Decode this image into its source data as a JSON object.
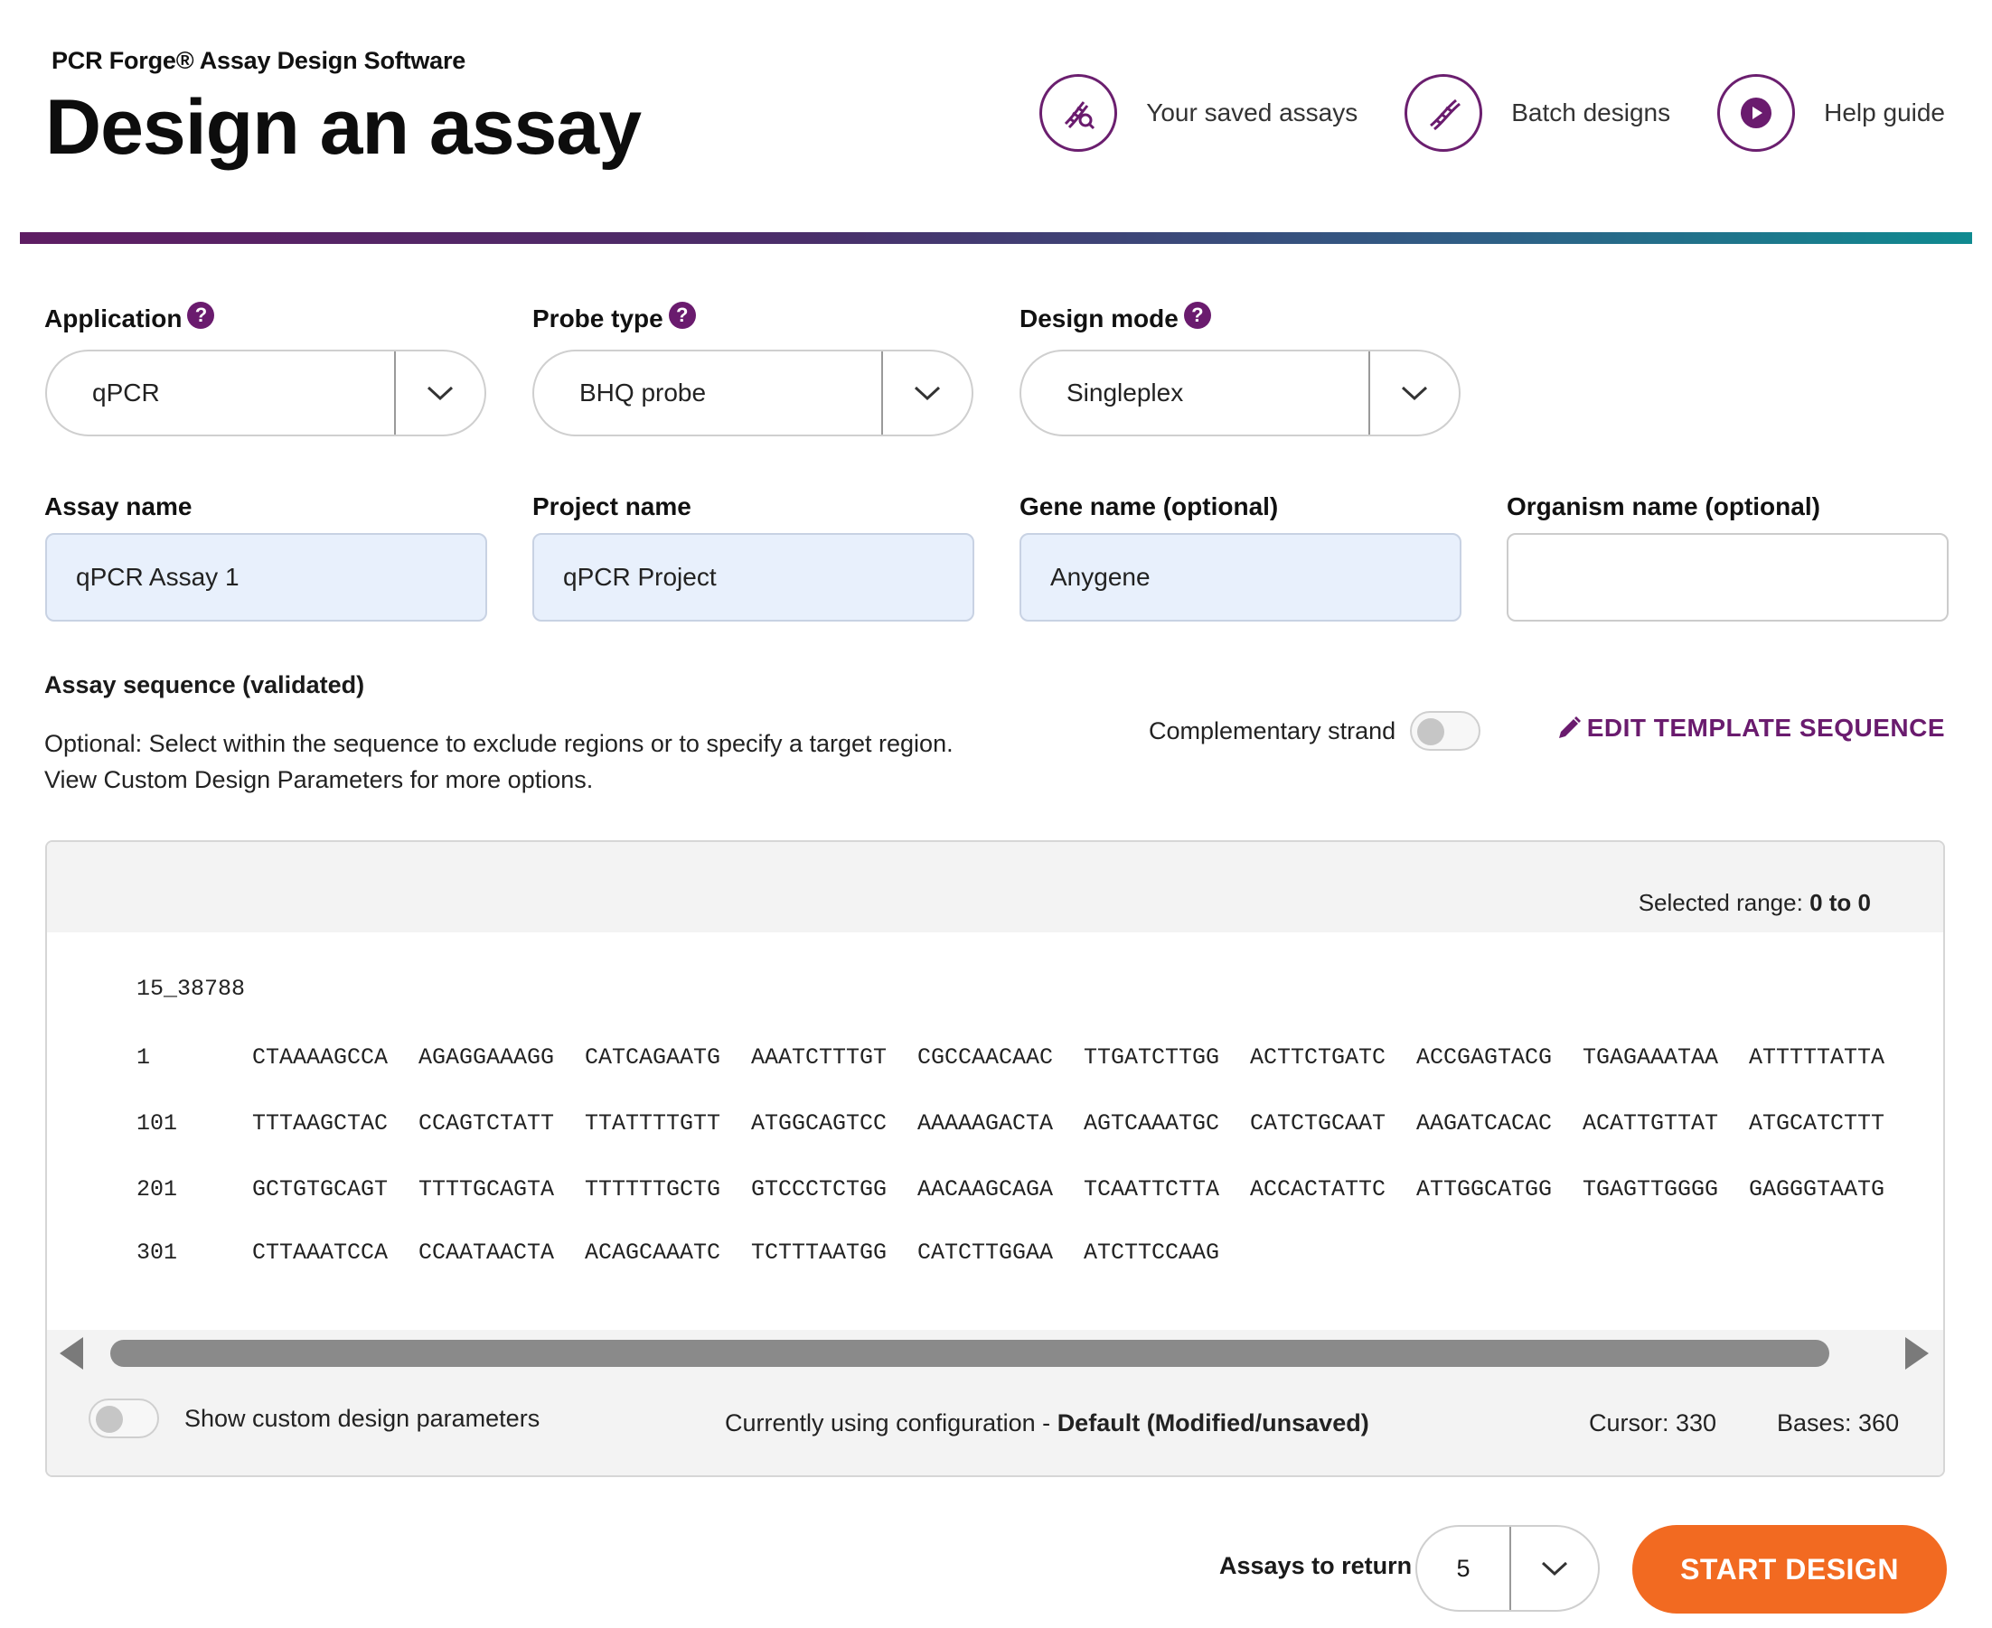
{
  "header": {
    "app_name": "PCR Forge® Assay Design Software",
    "page_title": "Design an assay",
    "nav": [
      {
        "label": "Your saved assays",
        "icon": "dna-search-icon"
      },
      {
        "label": "Batch designs",
        "icon": "dna-icon"
      },
      {
        "label": "Help guide",
        "icon": "play-icon"
      }
    ]
  },
  "colors": {
    "accent_purple": "#6a1b6e",
    "start_button": "#f26a21",
    "input_fill": "#e8f0fc"
  },
  "form": {
    "application": {
      "label": "Application",
      "value": "qPCR"
    },
    "probe_type": {
      "label": "Probe type",
      "value": "BHQ probe"
    },
    "design_mode": {
      "label": "Design mode",
      "value": "Singleplex"
    },
    "assay_name": {
      "label": "Assay name",
      "value": "qPCR Assay 1"
    },
    "project_name": {
      "label": "Project name",
      "value": "qPCR Project"
    },
    "gene_name": {
      "label": "Gene name (optional)",
      "value": "Anygene"
    },
    "organism_name": {
      "label": "Organism name (optional)",
      "value": ""
    }
  },
  "sequence_section": {
    "title": "Assay sequence (validated)",
    "hint_line1": "Optional: Select within the sequence to exclude regions or to specify a target region.",
    "hint_line2": "View Custom Design Parameters for more options.",
    "complementary_label": "Complementary strand",
    "complementary_on": false,
    "edit_link": "EDIT TEMPLATE SEQUENCE"
  },
  "sequence_panel": {
    "selected_range_label": "Selected range:",
    "selected_range_value": "0 to 0",
    "sequence_name": "15_38788",
    "rows": [
      {
        "num": "1",
        "chunks": [
          "CTAAAAGCCA",
          "AGAGGAAAGG",
          "CATCAGAATG",
          "AAATCTTTGT",
          "CGCCAACAAC",
          "TTGATCTTGG",
          "ACTTCTGATC",
          "ACCGAGTACG",
          "TGAGAAATAA",
          "ATTTTTATTA"
        ]
      },
      {
        "num": "101",
        "chunks": [
          "TTTAAGCTAC",
          "CCAGTCTATT",
          "TTATTTTGTT",
          "ATGGCAGTCC",
          "AAAAAGACTA",
          "AGTCAAATGC",
          "CATCTGCAAT",
          "AAGATCACAC",
          "ACATTGTTAT",
          "ATGCATCTTT"
        ]
      },
      {
        "num": "201",
        "chunks": [
          "GCTGTGCAGT",
          "TTTTGCAGTA",
          "TTTTTTGCTG",
          "GTCCCTCTGG",
          "AACAAGCAGA",
          "TCAATTCTTA",
          "ACCACTATTC",
          "ATTGGCATGG",
          "TGAGTTGGGG",
          "GAGGGTAATG"
        ]
      },
      {
        "num": "301",
        "chunks": [
          "CTTAAATCCA",
          "CCAATAACTA",
          "ACAGCAAATC",
          "TCTTTAATGG",
          "CATCTTGGAA",
          "ATCTTCCAAG"
        ]
      }
    ],
    "show_custom_label": "Show custom design parameters",
    "show_custom_on": false,
    "config_prefix": "Currently using configuration - ",
    "config_name": "Default (Modified/unsaved)",
    "cursor": "Cursor: 330",
    "bases": "Bases: 360"
  },
  "footer": {
    "assays_to_return_label": "Assays to return",
    "assays_to_return_value": "5",
    "start_button": "START DESIGN"
  }
}
